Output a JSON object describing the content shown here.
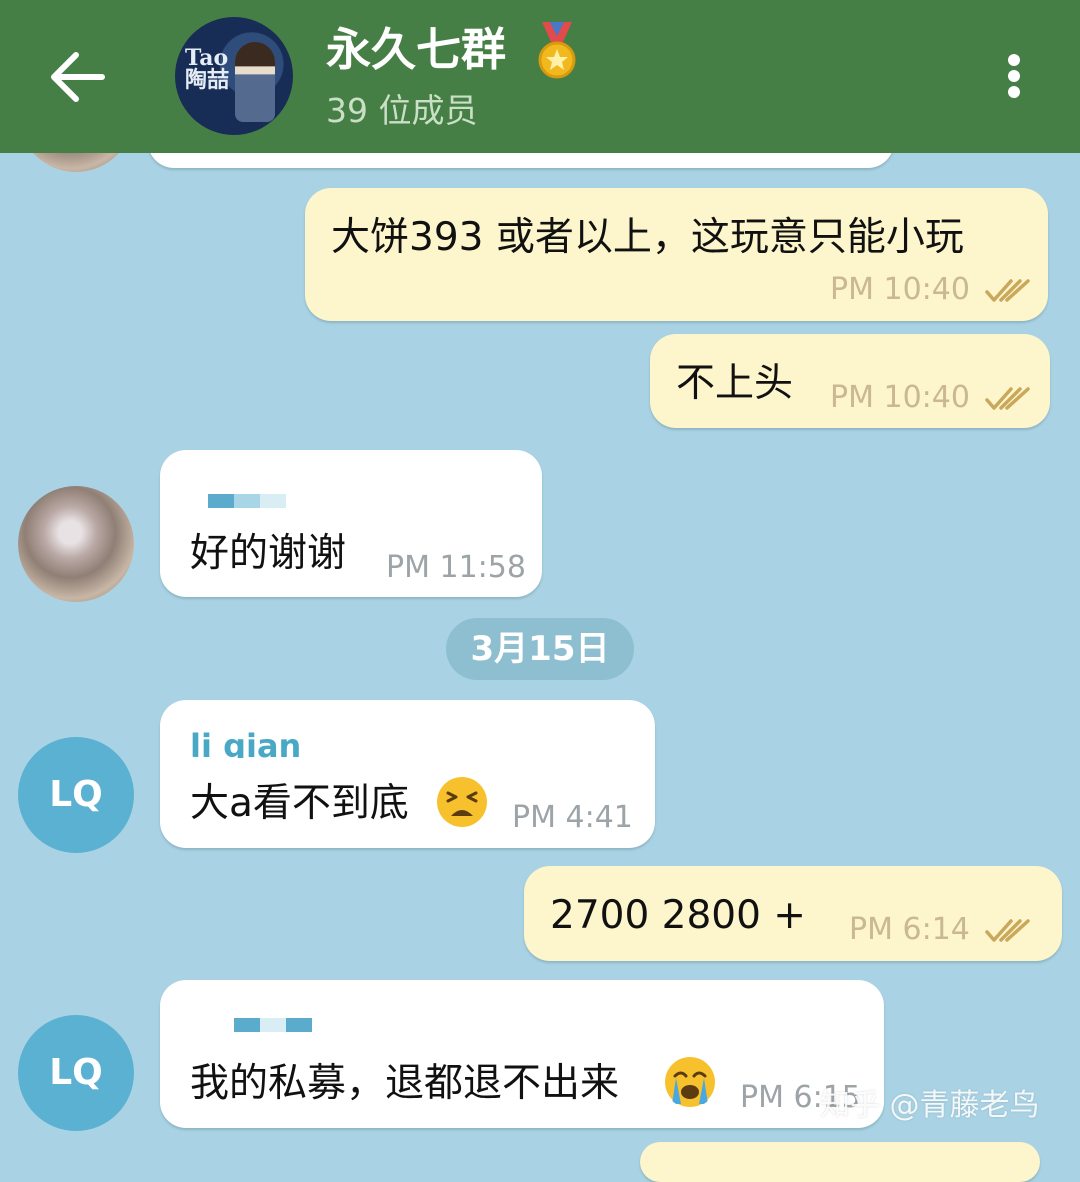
{
  "header": {
    "title": "永久七群",
    "subtitle": "39 位成员",
    "avatar_text": "Tao\n陶喆",
    "back_icon": "arrow-left-icon",
    "menu_icon": "more-vertical-icon",
    "badge_icon": "medal-icon"
  },
  "date_separator": "3月15日",
  "avatars": {
    "lq1": "LQ",
    "lq2": "LQ"
  },
  "messages": [
    {
      "direction": "out",
      "text": "大饼393 或者以上，这玩意只能小玩",
      "time": "PM 10:40",
      "status": "read"
    },
    {
      "direction": "out",
      "text": "不上头",
      "time": "PM 10:40",
      "status": "read"
    },
    {
      "direction": "in",
      "text": "好的谢谢",
      "time": "PM 11:58"
    },
    {
      "direction": "in",
      "sender": "li qian",
      "text": "大a看不到底",
      "emoji": "tired-face-emoji",
      "time": "PM 4:41"
    },
    {
      "direction": "out",
      "text": "2700   2800 +",
      "time": "PM 6:14",
      "status": "read"
    },
    {
      "direction": "in",
      "text": "我的私募，退都退不出来",
      "emoji": "loudly-crying-face-emoji",
      "time": "PM 6:15"
    }
  ],
  "watermark": "知乎 @青藤老鸟",
  "colors": {
    "header": "#467f45",
    "background": "#a9d3e4",
    "outgoing_bubble": "#fdf5cb",
    "incoming_bubble": "#ffffff",
    "accent": "#5bb1d1"
  }
}
